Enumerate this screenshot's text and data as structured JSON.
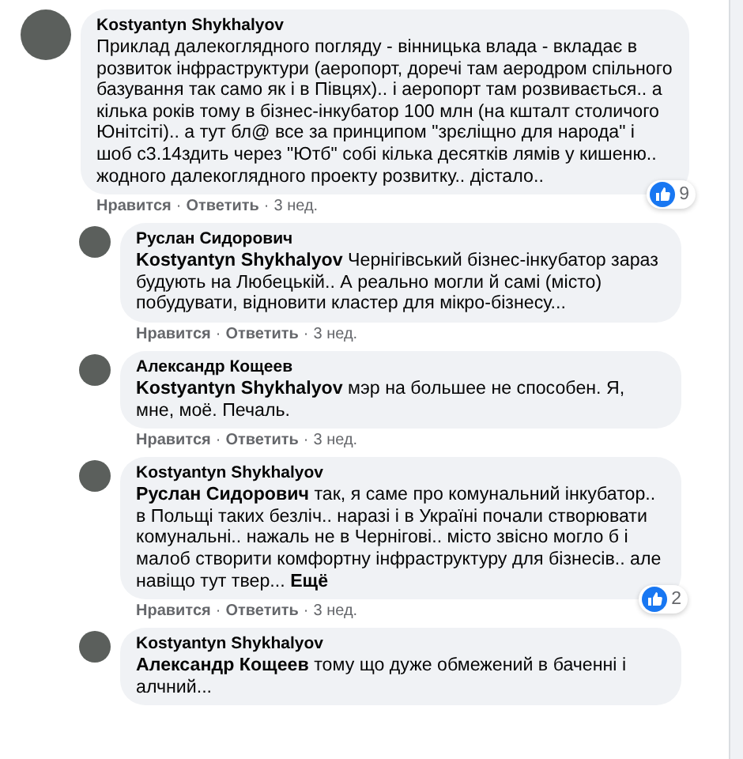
{
  "comments": [
    {
      "author": "Kostyantyn Shykhalyov",
      "text": "Приклад далекоглядного погляду - вінницька влада - вкладає в розвиток інфраструктури (аеропорт, доречі там аеродром спільного базування так само як і в Півцях).. і аеропорт там розвивається.. а кілька років тому в бізнес-інкубатор 100 млн (на кшталт столичого Юнітсіті).. а тут бл@ все за принципом \"зрєліщно для народа\" і шоб с3.14здить через \"Ютб\" собі кілька десятків лямів у кишеню.. жодного далекоглядного проекту розвитку.. дістало..",
      "reactions": "9",
      "actions": {
        "like": "Нравится",
        "separator": "·",
        "reply": "Ответить",
        "time": "3 нед."
      },
      "children": [
        {
          "author": "Руслан Сидорович",
          "mention": "Kostyantyn Shykhalyov",
          "text": "Чернігівський бізнес-інкубатор зараз будують на Любецькій.. А реально могли й самі (місто) побудувати, відновити кластер для мікро-бізнесу...",
          "actions": {
            "like": "Нравится",
            "separator": "·",
            "reply": "Ответить",
            "time": "3 нед."
          }
        },
        {
          "author": "Александр Кощеев",
          "mention": "Kostyantyn Shykhalyov",
          "text": "мэр на большее не способен. Я, мне, моё. Печаль.",
          "actions": {
            "like": "Нравится",
            "separator": "·",
            "reply": "Ответить",
            "time": "3 нед."
          }
        },
        {
          "author": "Kostyantyn Shykhalyov",
          "mention": "Руслан Сидорович",
          "text": "так, я саме про комунальний інкубатор.. в Польщі таких безліч.. наразі і в Україні почали створювати комунальні.. нажаль не в Чернігові.. місто звісно могло б і малоб створити комфортну інфраструктуру для бізнесів.. але навіщо тут твер...",
          "more": "Ещё",
          "reactions": "2",
          "actions": {
            "like": "Нравится",
            "separator": "·",
            "reply": "Ответить",
            "time": "3 нед."
          }
        },
        {
          "author": "Kostyantyn Shykhalyov",
          "mention": "Александр Кощеев",
          "text": "тому що дуже обмежений в баченні і алчний..."
        }
      ]
    }
  ]
}
